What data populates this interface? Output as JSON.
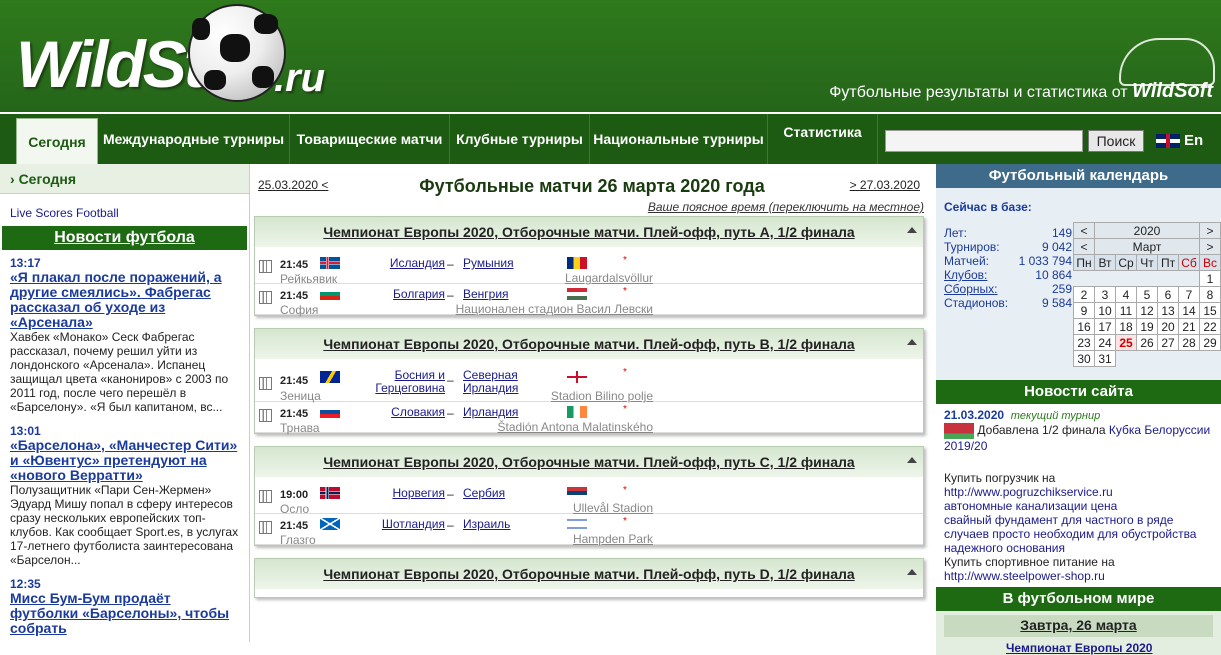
{
  "header": {
    "logo": "WildStat",
    "logo_suffix": ".ru",
    "tagline_prefix": "Футбольные результаты и статистика от ",
    "tagline_brand": "WildSoft"
  },
  "nav": [
    {
      "label": "Сегодня",
      "active": true
    },
    {
      "label": "Международные турниры"
    },
    {
      "label": "Товарищеские матчи"
    },
    {
      "label": "Клубные турниры"
    },
    {
      "label": "Национальные турниры"
    },
    {
      "label": "Статистика"
    }
  ],
  "search": {
    "button": "Поиск",
    "placeholder": ""
  },
  "lang": "En",
  "left": {
    "today": "Сегодня",
    "live": "Live Scores Football",
    "news_header": "Новости футбола",
    "news": [
      {
        "time": "13:17",
        "title": "«Я плакал после поражений, а другие смеялись». Фабрегас рассказал об уходе из «Арсенала»",
        "text": "Хавбек «Монако» Сеск Фабрегас рассказал, почему решил уйти из лондонского «Арсенала». Испанец защищал цвета «канониров» с 2003 по 2011 год, после чего перешёл в «Барселону». «Я был капитаном, вс..."
      },
      {
        "time": "13:01",
        "title": "«Барселона», «Манчестер Сити» и «Ювентус» претендуют на «нового Верратти»",
        "text": "Полузащитник «Пари Сен-Жермен» Эдуард Мишу попал в сферу интересов сразу нескольких европейских топ-клубов. Как сообщает Sport.es, в услугах 17-летнего футболиста заинтересована «Барселон..."
      },
      {
        "time": "12:35",
        "title": "Мисс Бум-Бум продаёт футболки «Барселоны», чтобы собрать",
        "text": ""
      }
    ]
  },
  "center": {
    "prev": "25.03.2020 <",
    "next": "> 27.03.2020",
    "title": "Футбольные матчи 26 марта 2020 года",
    "tz": "Ваше поясное время (переключить на местное)",
    "groups": [
      {
        "title": "Чемпионат Европы 2020, Отборочные матчи. Плей-офф, путь A, 1/2 финала",
        "matches": [
          {
            "time": "21:45",
            "city": "Рейкьявик",
            "home": "Исландия",
            "away": "Румыния",
            "venue": "Laugardalsvöllur",
            "f1": "iceland",
            "f2": "romania"
          },
          {
            "time": "21:45",
            "city": "София",
            "home": "Болгария",
            "away": "Венгрия",
            "venue": "Национален стадион Васил Левски",
            "f1": "bulgaria",
            "f2": "hungary"
          }
        ]
      },
      {
        "title": "Чемпионат Европы 2020, Отборочные матчи. Плей-офф, путь B, 1/2 финала",
        "matches": [
          {
            "time": "21:45",
            "city": "Зеница",
            "home": "Босния и Герцеговина",
            "away": "Северная Ирландия",
            "venue": "Stadion Bilino polje",
            "f1": "bosnia",
            "f2": "nireland",
            "tall": true
          },
          {
            "time": "21:45",
            "city": "Трнава",
            "home": "Словакия",
            "away": "Ирландия",
            "venue": "Štadión Antona Malatinského",
            "f1": "slovakia",
            "f2": "ireland"
          }
        ]
      },
      {
        "title": "Чемпионат Европы 2020, Отборочные матчи. Плей-офф, путь C, 1/2 финала",
        "matches": [
          {
            "time": "19:00",
            "city": "Осло",
            "home": "Норвегия",
            "away": "Сербия",
            "venue": "Ullevål Stadion",
            "f1": "norway",
            "f2": "serbia"
          },
          {
            "time": "21:45",
            "city": "Глазго",
            "home": "Шотландия",
            "away": "Израиль",
            "venue": "Hampden Park",
            "f1": "scotland",
            "f2": "israel"
          }
        ]
      },
      {
        "title": "Чемпионат Европы 2020, Отборочные матчи. Плей-офф, путь D, 1/2 финала",
        "matches": []
      }
    ]
  },
  "right": {
    "cal_header": "Футбольный календарь",
    "base_title": "Сейчас в базе:",
    "stats": [
      {
        "label": "Лет:",
        "value": "149",
        "link": false
      },
      {
        "label": "Турниров:",
        "value": "9 042",
        "link": false
      },
      {
        "label": "Матчей:",
        "value": "1 033 794",
        "link": false
      },
      {
        "label": "Клубов:",
        "value": "10 864",
        "link": true
      },
      {
        "label": "Сборных:",
        "value": "259",
        "link": true
      },
      {
        "label": "Стадионов:",
        "value": "9 584",
        "link": false
      }
    ],
    "year": "2020",
    "month": "Март",
    "weekdays": [
      "Пн",
      "Вт",
      "Ср",
      "Чт",
      "Пт",
      "Сб",
      "Вс"
    ],
    "weeks": [
      [
        "",
        "",
        "",
        "",
        "",
        "",
        "1"
      ],
      [
        "2",
        "3",
        "4",
        "5",
        "6",
        "7",
        "8"
      ],
      [
        "9",
        "10",
        "11",
        "12",
        "13",
        "14",
        "15"
      ],
      [
        "16",
        "17",
        "18",
        "19",
        "20",
        "21",
        "22"
      ],
      [
        "23",
        "24",
        "25",
        "26",
        "27",
        "28",
        "29"
      ],
      [
        "30",
        "31",
        "",
        "",
        "",
        "",
        ""
      ]
    ],
    "today_day": "25",
    "site_news_header": "Новости сайта",
    "site_news": {
      "date": "21.03.2020",
      "current": "текущий турнир",
      "text": "Добавлена 1/2 финала ",
      "link": "Кубка Белоруссии 2019/20"
    },
    "ads": [
      {
        "text": "Купить погрузчик на"
      },
      {
        "link": "http://www.pogruzchikservice.ru"
      },
      {
        "link": "автономные канализации цена"
      },
      {
        "link": "свайный фундамент для частного в ряде случаев просто необходим для обустройства надежного основания"
      },
      {
        "text": "Купить спортивное питание на"
      },
      {
        "link": "http://www.steelpower-shop.ru"
      }
    ],
    "world_header": "В футбольном мире",
    "tomorrow": "Завтра, 26 марта",
    "competition": "Чемпионат Европы 2020"
  },
  "colors": {
    "green": "#1d5a12",
    "blue_header": "#3e6b8a",
    "link": "#1a1a8c"
  }
}
